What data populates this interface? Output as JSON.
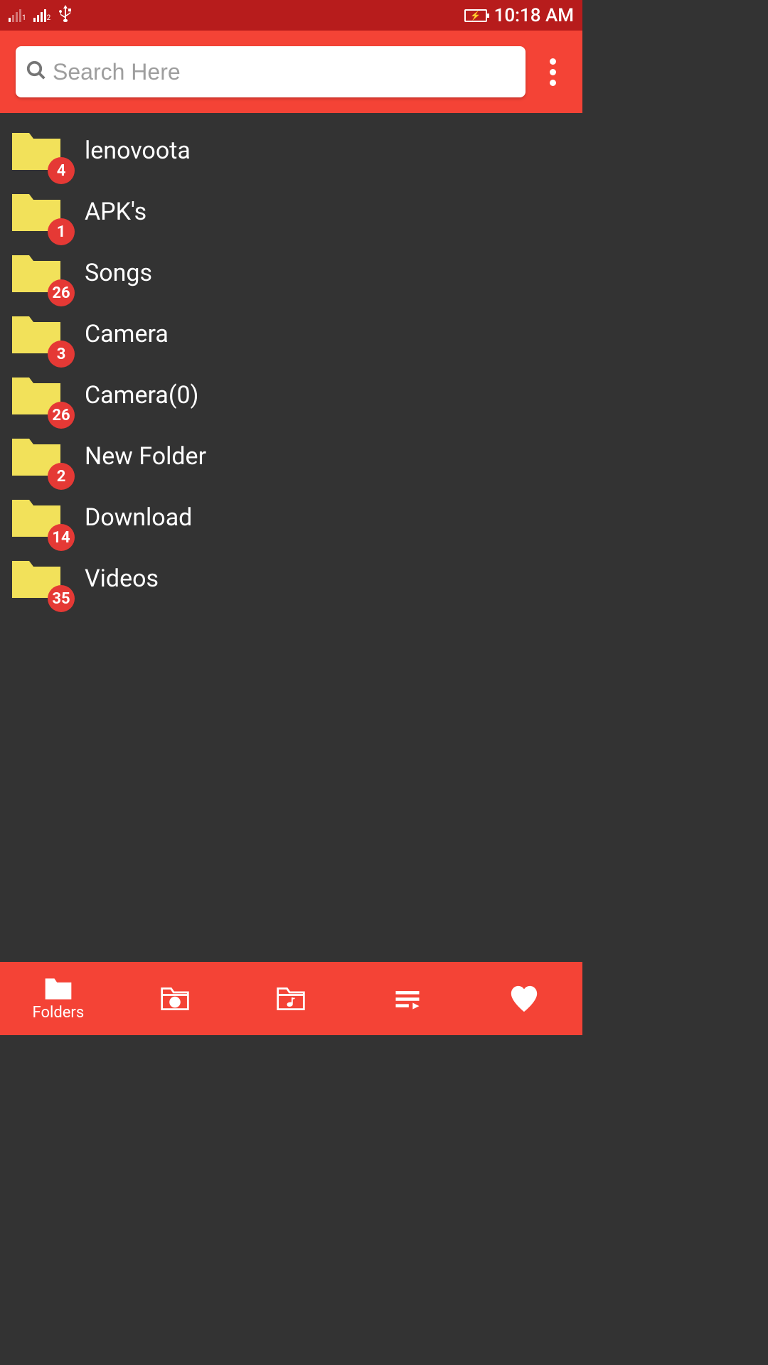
{
  "status": {
    "time": "10:18 AM"
  },
  "search": {
    "placeholder": "Search Here",
    "value": ""
  },
  "folders": [
    {
      "name": "lenovoota",
      "count": 4
    },
    {
      "name": "APK's",
      "count": 1
    },
    {
      "name": "Songs",
      "count": 26
    },
    {
      "name": "Camera",
      "count": 3
    },
    {
      "name": "Camera(0)",
      "count": 26
    },
    {
      "name": "New Folder",
      "count": 2
    },
    {
      "name": "Download",
      "count": 14
    },
    {
      "name": "Videos",
      "count": 35
    }
  ],
  "nav": {
    "folders_label": "Folders"
  }
}
